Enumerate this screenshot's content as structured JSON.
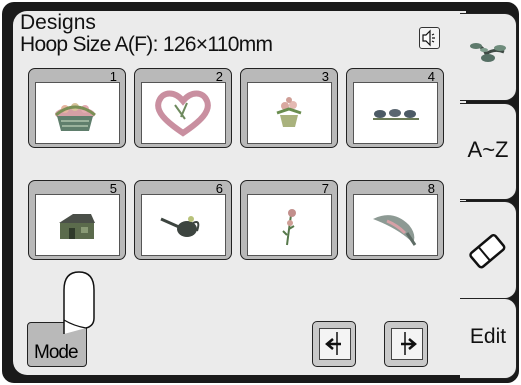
{
  "header": {
    "title": "Designs",
    "hoop_size": "Hoop Size A(F): 126×110mm",
    "speaker_icon": "speaker-icon"
  },
  "designs": [
    {
      "number": "1",
      "icon": "flower-basket-icon"
    },
    {
      "number": "2",
      "icon": "heart-wreath-icon"
    },
    {
      "number": "3",
      "icon": "flower-pot-icon"
    },
    {
      "number": "4",
      "icon": "birds-on-branch-icon"
    },
    {
      "number": "5",
      "icon": "cottage-icon"
    },
    {
      "number": "6",
      "icon": "watering-can-icon"
    },
    {
      "number": "7",
      "icon": "single-flower-icon"
    },
    {
      "number": "8",
      "icon": "sun-hat-icon"
    }
  ],
  "footer": {
    "mode_label": "Mode",
    "prev_page_icon": "page-back-arrow-icon",
    "next_page_icon": "page-forward-arrow-icon"
  },
  "tabs": [
    {
      "label": "",
      "icon": "floral-pattern-icon"
    },
    {
      "label": "A~Z"
    },
    {
      "label": "",
      "icon": "eraser-icon"
    },
    {
      "label": "Edit"
    }
  ],
  "colors": {
    "screen_border": "#1a1a1a",
    "panel_bg": "#ebebeb",
    "button_gray": "#b9b9b9",
    "embroidery_green": "#4b7a3a",
    "embroidery_pink": "#d6a0a6"
  }
}
